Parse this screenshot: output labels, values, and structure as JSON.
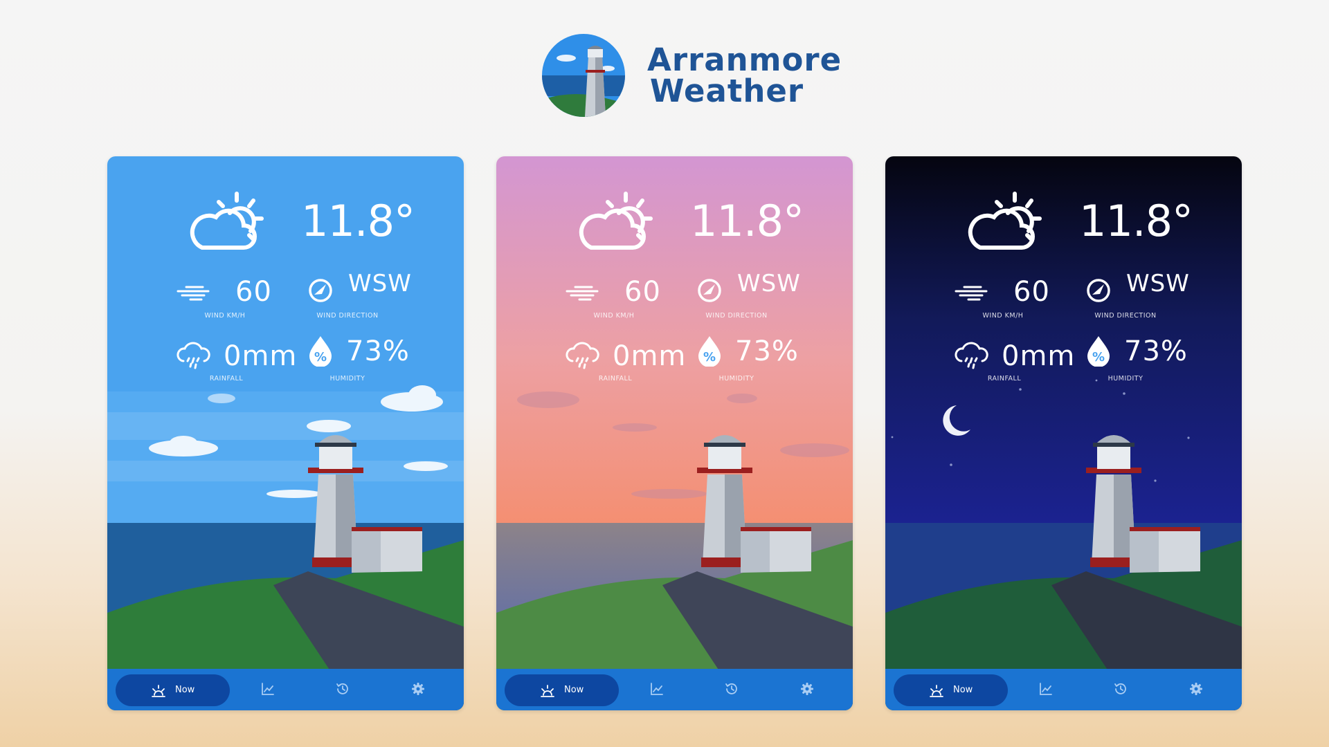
{
  "app": {
    "title_line1": "Arranmore",
    "title_line2": "Weather",
    "logo_icon": "lighthouse-logo-icon",
    "brand_color": "#1f5496"
  },
  "cards": [
    {
      "theme": "day",
      "weather_icon": "partly-cloudy-icon",
      "temperature": "11.8°",
      "wind": {
        "value": "60",
        "caption": "WIND KM/H",
        "icon": "wind-icon"
      },
      "direction": {
        "value": "WSW",
        "caption": "WIND DIRECTION",
        "icon": "compass-icon"
      },
      "rainfall": {
        "value": "0mm",
        "caption": "RAINFALL",
        "icon": "rain-cloud-icon"
      },
      "humidity": {
        "value": "73%",
        "caption": "HUMIDITY",
        "icon": "humidity-drop-icon"
      },
      "nav": {
        "now_label": "Now",
        "items": [
          "now-tab",
          "chart-tab",
          "history-tab",
          "settings-tab"
        ]
      }
    },
    {
      "theme": "sunset",
      "weather_icon": "partly-cloudy-icon",
      "temperature": "11.8°",
      "wind": {
        "value": "60",
        "caption": "WIND KM/H",
        "icon": "wind-icon"
      },
      "direction": {
        "value": "WSW",
        "caption": "WIND DIRECTION",
        "icon": "compass-icon"
      },
      "rainfall": {
        "value": "0mm",
        "caption": "RAINFALL",
        "icon": "rain-cloud-icon"
      },
      "humidity": {
        "value": "73%",
        "caption": "HUMIDITY",
        "icon": "humidity-drop-icon"
      },
      "nav": {
        "now_label": "Now",
        "items": [
          "now-tab",
          "chart-tab",
          "history-tab",
          "settings-tab"
        ]
      }
    },
    {
      "theme": "night",
      "weather_icon": "partly-cloudy-icon",
      "temperature": "11.8°",
      "wind": {
        "value": "60",
        "caption": "WIND KM/H",
        "icon": "wind-icon"
      },
      "direction": {
        "value": "WSW",
        "caption": "WIND DIRECTION",
        "icon": "compass-icon"
      },
      "rainfall": {
        "value": "0mm",
        "caption": "RAINFALL",
        "icon": "rain-cloud-icon"
      },
      "humidity": {
        "value": "73%",
        "caption": "HUMIDITY",
        "icon": "humidity-drop-icon"
      },
      "nav": {
        "now_label": "Now",
        "items": [
          "now-tab",
          "chart-tab",
          "history-tab",
          "settings-tab"
        ]
      }
    }
  ],
  "colors": {
    "day_sky": "#4aa3ef",
    "sunset_sky_top": "#d396d2",
    "sunset_sky_bottom": "#f3957b",
    "night_sky_top": "#050510",
    "night_sky_bottom": "#1b2290",
    "nav_bar": "#1b74d2",
    "nav_active": "#0d47a1"
  }
}
